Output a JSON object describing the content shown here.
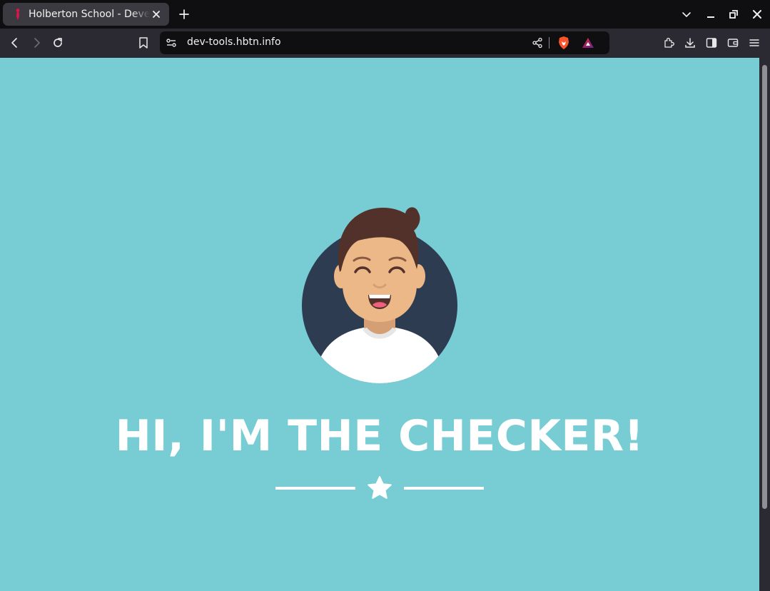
{
  "browser": {
    "tab": {
      "title": "Holberton School - Developer Tools"
    },
    "url": "dev-tools.hbtn.info",
    "icons": {
      "favicon": "holberton-favicon",
      "tab_close": "close-icon",
      "new_tab": "plus-icon",
      "tab_list": "chevron-down-icon",
      "minimize": "minimize-icon",
      "restore": "restore-icon",
      "close": "close-icon",
      "back": "back-arrow-icon",
      "forward": "forward-arrow-icon",
      "reload": "reload-icon",
      "bookmark": "bookmark-icon",
      "site_info": "site-controls-icon",
      "share": "share-icon",
      "brave_shields": "brave-lion-icon",
      "brave_rewards": "rewards-triangle-icon",
      "extensions": "puzzle-icon",
      "downloads": "download-icon",
      "sidebar": "sidebar-icon",
      "wallet": "wallet-icon",
      "menu": "hamburger-menu-icon"
    }
  },
  "page": {
    "background_color": "#77cdd3",
    "avatar": "smiling-man-avatar",
    "heading": "HI, I'M THE CHECKER!",
    "divider_icon": "star-icon"
  }
}
